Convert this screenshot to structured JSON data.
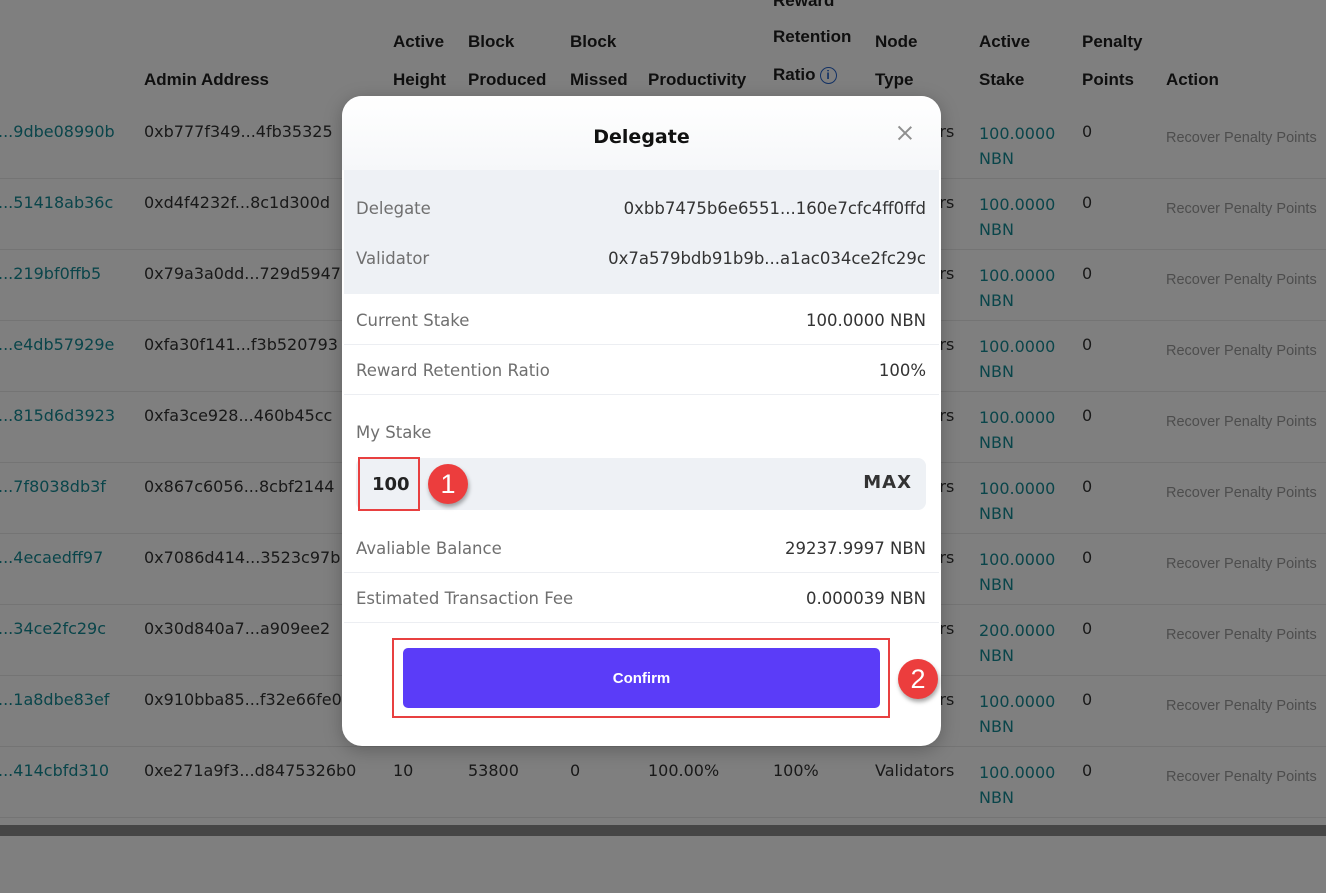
{
  "table": {
    "headers": {
      "admin_address": "Admin Address",
      "active_height_1": "Active",
      "active_height_2": "Height",
      "block_produced_1": "Block",
      "block_produced_2": "Produced",
      "block_missed_1": "Block",
      "block_missed_2": "Missed",
      "productivity": "Productivity",
      "reward_retention_1": "Reward",
      "reward_retention_2": "Retention",
      "reward_retention_3": "Ratio",
      "node_type_1": "Node",
      "node_type_2": "Type",
      "active_stake_1": "Active",
      "active_stake_2": "Stake",
      "penalty_points_1": "Penalty",
      "penalty_points_2": "Points",
      "action": "Action",
      "info_icon": "i"
    },
    "rows": [
      {
        "validator": "...9dbe08990b",
        "admin": "0xb777f349...4fb35325",
        "node_type": "Validators",
        "stake_amount": "100.0000",
        "stake_unit": "NBN",
        "penalty": "0",
        "action": "Recover Penalty Points"
      },
      {
        "validator": "...51418ab36c",
        "admin": "0xd4f4232f...8c1d300d",
        "node_type": "Validators",
        "stake_amount": "100.0000",
        "stake_unit": "NBN",
        "penalty": "0",
        "action": "Recover Penalty Points"
      },
      {
        "validator": "...219bf0ffb5",
        "admin": "0x79a3a0dd...729d5947",
        "node_type": "Validators",
        "stake_amount": "100.0000",
        "stake_unit": "NBN",
        "penalty": "0",
        "action": "Recover Penalty Points"
      },
      {
        "validator": "...e4db57929e",
        "admin": "0xfa30f141...f3b520793",
        "node_type": "Validators",
        "stake_amount": "100.0000",
        "stake_unit": "NBN",
        "penalty": "0",
        "action": "Recover Penalty Points"
      },
      {
        "validator": "...815d6d3923",
        "admin": "0xfa3ce928...460b45cc",
        "node_type": "Validators",
        "stake_amount": "100.0000",
        "stake_unit": "NBN",
        "penalty": "0",
        "action": "Recover Penalty Points"
      },
      {
        "validator": "...7f8038db3f",
        "admin": "0x867c6056...8cbf2144",
        "node_type": "Validators",
        "stake_amount": "100.0000",
        "stake_unit": "NBN",
        "penalty": "0",
        "action": "Recover Penalty Points"
      },
      {
        "validator": "...4ecaedff97",
        "admin": "0x7086d414...3523c97b",
        "node_type": "Validators",
        "stake_amount": "100.0000",
        "stake_unit": "NBN",
        "penalty": "0",
        "action": "Recover Penalty Points"
      },
      {
        "validator": "...34ce2fc29c",
        "admin": "0x30d840a7...a909ee2",
        "node_type": "Validators",
        "stake_amount": "200.0000",
        "stake_unit": "NBN",
        "penalty": "0",
        "action": "Recover Penalty Points"
      },
      {
        "validator": "...1a8dbe83ef",
        "admin": "0x910bba85...f32e66fe0",
        "node_type": "Validators",
        "stake_amount": "100.0000",
        "stake_unit": "NBN",
        "penalty": "0",
        "action": "Recover Penalty Points"
      },
      {
        "validator": "...414cbfd310",
        "admin": "0xe271a9f3...d8475326b0",
        "active_height": "10",
        "block_produced": "53800",
        "block_missed": "0",
        "productivity": "100.00%",
        "reward_ratio": "100%",
        "node_type": "Validators",
        "stake_amount": "100.0000",
        "stake_unit": "NBN",
        "penalty": "0",
        "action": "Recover Penalty Points"
      }
    ]
  },
  "modal": {
    "title": "Delegate",
    "delegate_label": "Delegate",
    "delegate_value": "0xbb7475b6e6551...160e7cfc4ff0ffd",
    "validator_label": "Validator",
    "validator_value": "0x7a579bdb91b9b...a1ac034ce2fc29c",
    "current_stake_label": "Current Stake",
    "current_stake_value": "100.0000 NBN",
    "reward_ratio_label": "Reward Retention Ratio",
    "reward_ratio_value": "100%",
    "my_stake_label": "My Stake",
    "my_stake_value": "100",
    "max_label": "MAX",
    "balance_label": "Avaliable Balance",
    "balance_value": "29237.9997 NBN",
    "fee_label": "Estimated Transaction Fee",
    "fee_value": "0.000039 NBN",
    "confirm_label": "Confirm"
  },
  "annotations": {
    "step1": "1",
    "step2": "2"
  },
  "colors": {
    "accent": "#5b3cf8",
    "link": "#158a95",
    "annotation": "#e84040"
  }
}
